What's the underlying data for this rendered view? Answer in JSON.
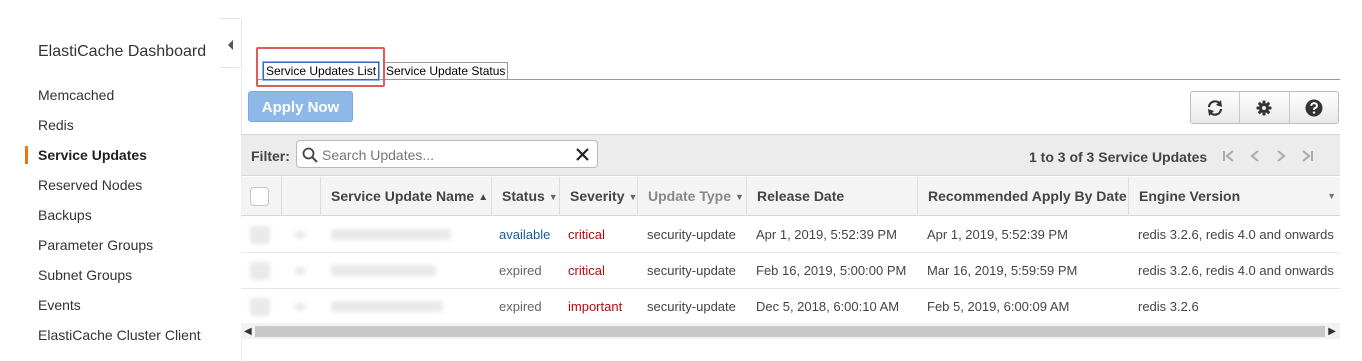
{
  "sidebar": {
    "title": "ElastiCache Dashboard",
    "items": [
      {
        "label": "Memcached"
      },
      {
        "label": "Redis"
      },
      {
        "label": "Service Updates",
        "active": true
      },
      {
        "label": "Reserved Nodes"
      },
      {
        "label": "Backups"
      },
      {
        "label": "Parameter Groups"
      },
      {
        "label": "Subnet Groups"
      },
      {
        "label": "Events"
      },
      {
        "label": "ElastiCache Cluster Client"
      }
    ]
  },
  "tabs": [
    {
      "label": "Service Updates List",
      "active": true
    },
    {
      "label": "Service Update Status",
      "active": false
    }
  ],
  "toolbar": {
    "apply_label": "Apply Now",
    "icons": [
      "refresh-icon",
      "gear-icon",
      "help-icon"
    ]
  },
  "filter": {
    "label": "Filter:",
    "placeholder": "Search Updates...",
    "value": ""
  },
  "pager": {
    "text": "1 to 3 of 3 Service Updates"
  },
  "table": {
    "columns": [
      {
        "label": "Service Update Name",
        "sort": "asc"
      },
      {
        "label": "Status",
        "sort": "menu"
      },
      {
        "label": "Severity",
        "sort": "menu"
      },
      {
        "label": "Update Type",
        "sort": "menu"
      },
      {
        "label": "Release Date"
      },
      {
        "label": "Recommended Apply By Date"
      },
      {
        "label": "Engine Version"
      }
    ],
    "rows": [
      {
        "status": "available",
        "severity": "critical",
        "update_type": "security-update",
        "release_date": "Apr 1, 2019, 5:52:39 PM",
        "apply_by": "Apr 1, 2019, 5:52:39 PM",
        "engine_version": "redis 3.2.6, redis 4.0 and onwards"
      },
      {
        "status": "expired",
        "severity": "critical",
        "update_type": "security-update",
        "release_date": "Feb 16, 2019, 5:00:00 PM",
        "apply_by": "Mar 16, 2019, 5:59:59 PM",
        "engine_version": "redis 3.2.6, redis 4.0 and onwards"
      },
      {
        "status": "expired",
        "severity": "important",
        "update_type": "security-update",
        "release_date": "Dec 5, 2018, 6:00:10 AM",
        "apply_by": "Feb 5, 2019, 6:00:09 AM",
        "engine_version": "redis 3.2.6"
      }
    ]
  },
  "colors": {
    "accent_active_nav": "#e47911",
    "apply_button": "#8db8e8",
    "status_available": "#1a5c9e",
    "severity": "#b20a0a",
    "highlight_box": "#e05a5a"
  }
}
